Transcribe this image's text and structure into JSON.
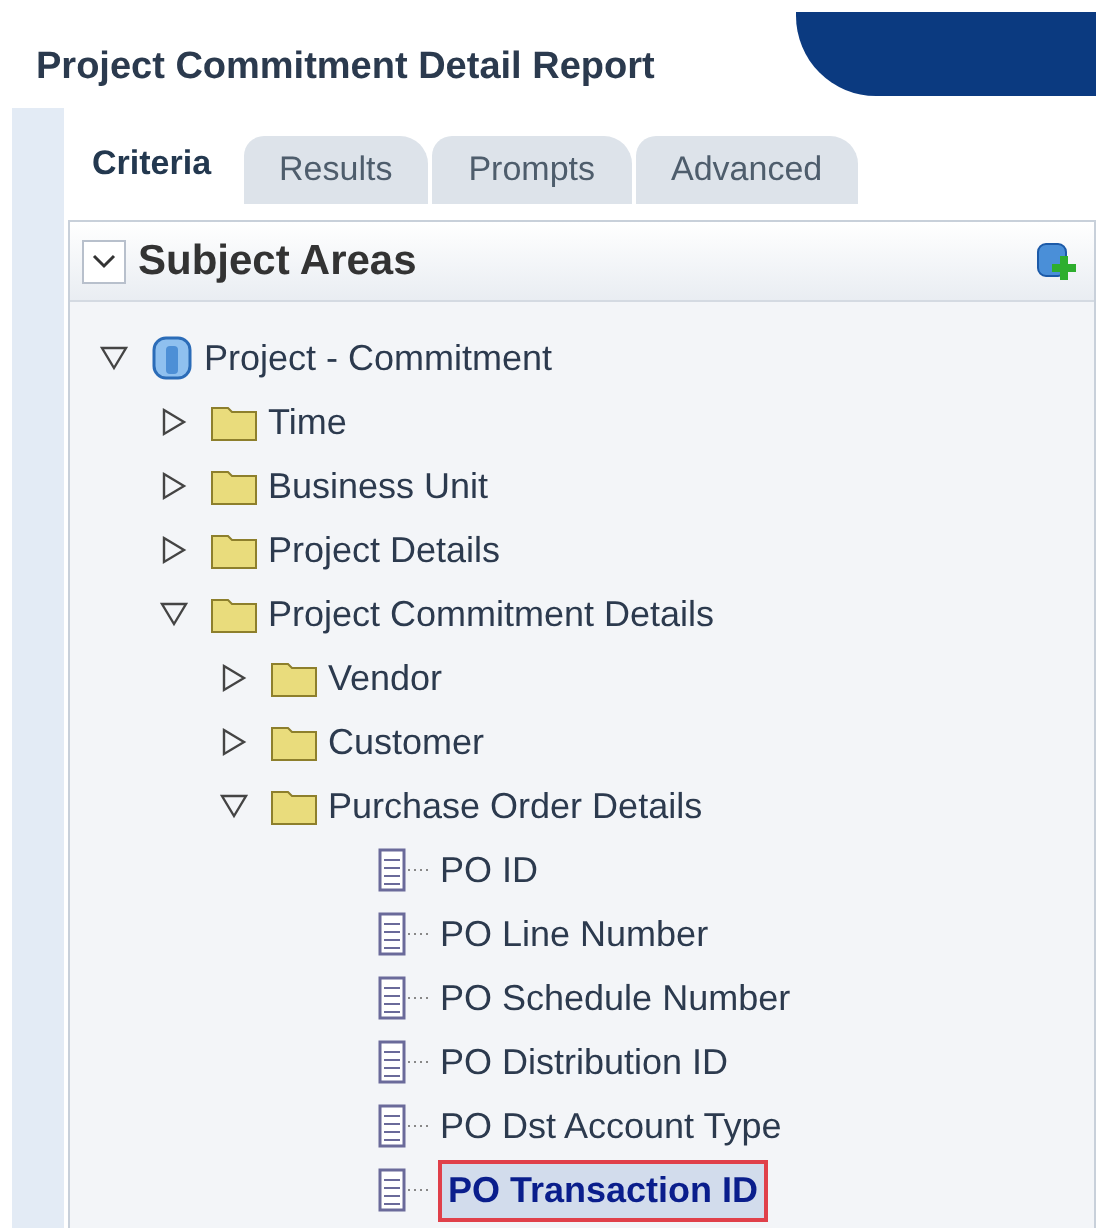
{
  "title": "Project Commitment Detail Report",
  "tabs": [
    {
      "label": "Criteria",
      "selected": true
    },
    {
      "label": "Results",
      "selected": false
    },
    {
      "label": "Prompts",
      "selected": false
    },
    {
      "label": "Advanced",
      "selected": false
    }
  ],
  "panel": {
    "title": "Subject Areas",
    "expanded": true
  },
  "tree": [
    {
      "kind": "subject-area",
      "label": "Project - Commitment",
      "expanded": true,
      "selected": false,
      "children": [
        {
          "kind": "folder",
          "label": "Time",
          "expanded": false,
          "selected": false
        },
        {
          "kind": "folder",
          "label": "Business Unit",
          "expanded": false,
          "selected": false
        },
        {
          "kind": "folder",
          "label": "Project Details",
          "expanded": false,
          "selected": false
        },
        {
          "kind": "folder",
          "label": "Project Commitment Details",
          "expanded": true,
          "selected": false,
          "children": [
            {
              "kind": "folder",
              "label": "Vendor",
              "expanded": false,
              "selected": false
            },
            {
              "kind": "folder",
              "label": "Customer",
              "expanded": false,
              "selected": false
            },
            {
              "kind": "folder",
              "label": "Purchase Order Details",
              "expanded": true,
              "selected": false,
              "children": [
                {
                  "kind": "column",
                  "label": "PO ID",
                  "selected": false
                },
                {
                  "kind": "column",
                  "label": "PO Line Number",
                  "selected": false
                },
                {
                  "kind": "column",
                  "label": "PO Schedule Number",
                  "selected": false
                },
                {
                  "kind": "column",
                  "label": "PO Distribution ID",
                  "selected": false
                },
                {
                  "kind": "column",
                  "label": "PO Dst Account Type",
                  "selected": false
                },
                {
                  "kind": "column",
                  "label": "PO Transaction ID",
                  "selected": true
                }
              ]
            }
          ]
        }
      ]
    }
  ]
}
